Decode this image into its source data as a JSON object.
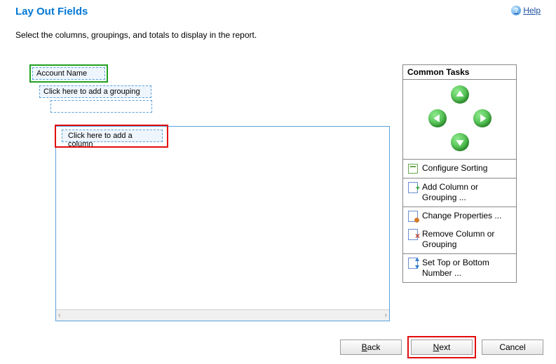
{
  "header": {
    "title": "Lay Out Fields",
    "help_label": "Help"
  },
  "instruction": "Select the columns, groupings, and totals to display in the report.",
  "fields": {
    "account_name": "Account Name",
    "add_grouping": "Click here to add a grouping",
    "add_column": "Click here to add a column"
  },
  "tasks": {
    "header": "Common Tasks",
    "configure_sorting": "Configure Sorting",
    "add_column": "Add Column or Grouping ...",
    "change_properties": "Change Properties ...",
    "remove_column": "Remove Column or Grouping",
    "set_top_bottom": "Set Top or Bottom Number ..."
  },
  "buttons": {
    "back": "Back",
    "next": "Next",
    "cancel": "Cancel"
  }
}
